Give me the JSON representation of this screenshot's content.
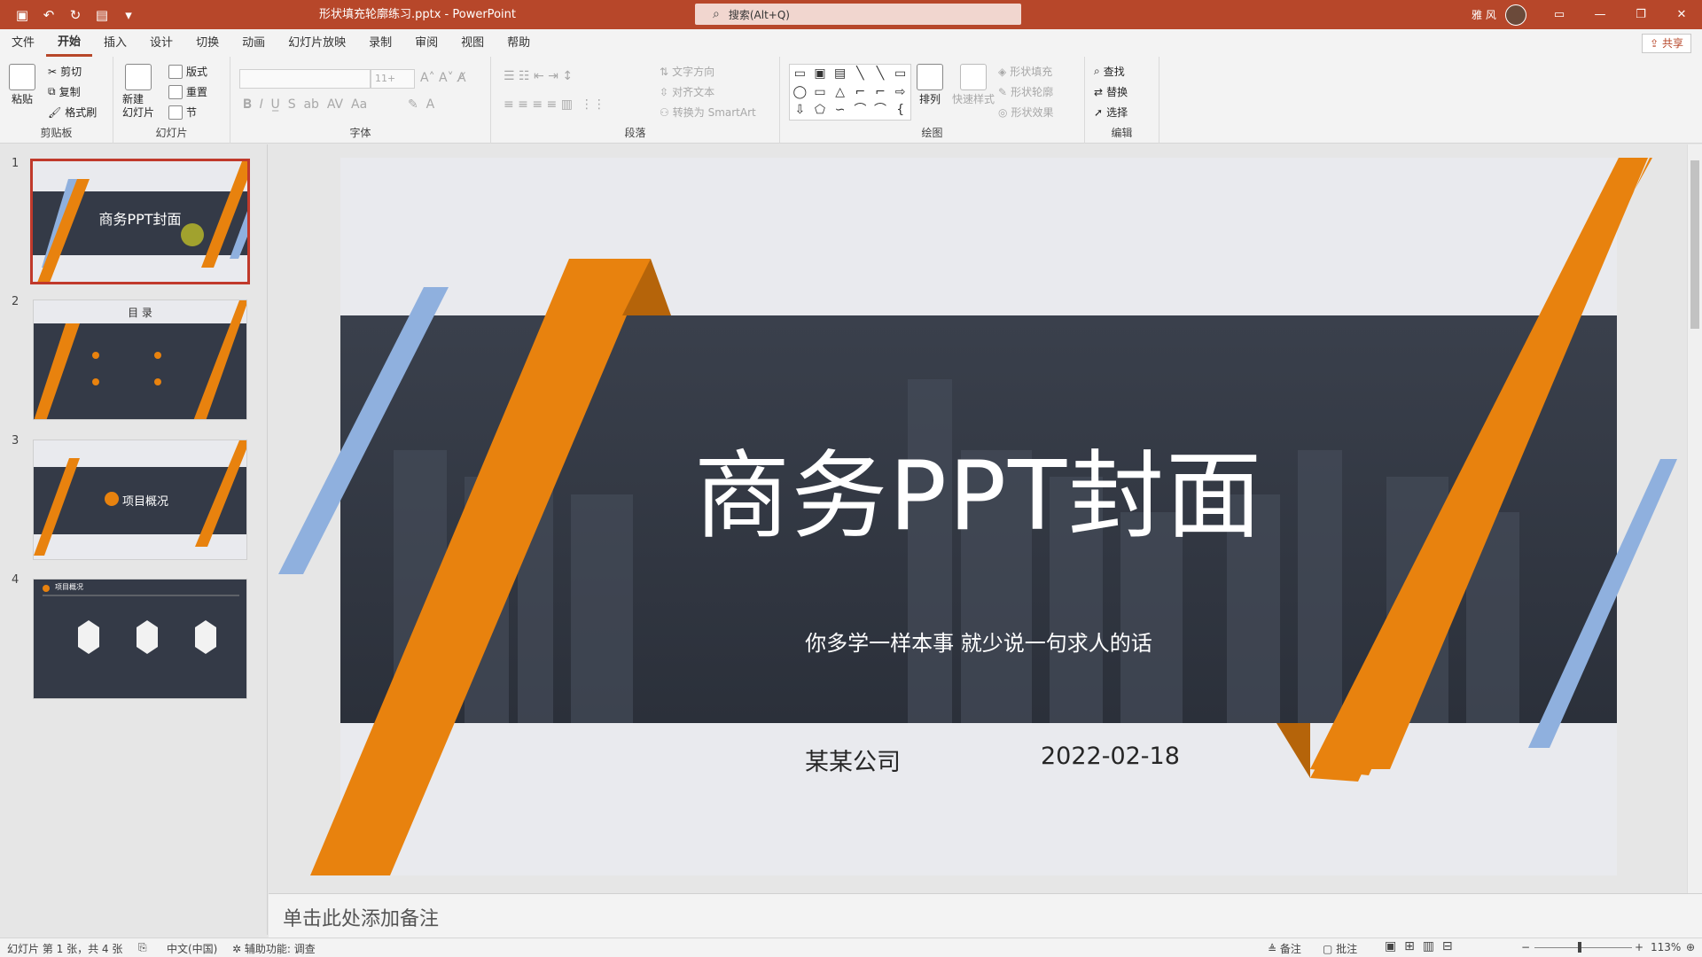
{
  "titlebar": {
    "doc_title": "形状填充轮廓练习.pptx  -  PowerPoint",
    "search_placeholder": "搜索(Alt+Q)",
    "user_name": "雅 风",
    "share_label": "共享"
  },
  "tabs": [
    "文件",
    "开始",
    "插入",
    "设计",
    "切换",
    "动画",
    "幻灯片放映",
    "录制",
    "审阅",
    "视图",
    "帮助"
  ],
  "active_tab": "开始",
  "ribbon": {
    "clipboard": {
      "label": "剪贴板",
      "paste": "粘贴",
      "cut": "剪切",
      "copy": "复制",
      "format_painter": "格式刷"
    },
    "slides": {
      "label": "幻灯片",
      "new_slide": "新建\n幻灯片",
      "layout": "版式",
      "reset": "重置",
      "section": "节"
    },
    "font": {
      "label": "字体",
      "size_placeholder": "11+"
    },
    "paragraph": {
      "label": "段落",
      "text_direction": "文字方向",
      "align_text": "对齐文本",
      "smartart": "转换为 SmartArt"
    },
    "drawing": {
      "label": "绘图",
      "arrange": "排列",
      "quick_styles": "快速样式",
      "shape_fill": "形状填充",
      "shape_outline": "形状轮廓",
      "shape_effects": "形状效果"
    },
    "editing": {
      "label": "编辑",
      "find": "查找",
      "replace": "替换",
      "select": "选择"
    }
  },
  "thumbnails": [
    {
      "num": "1",
      "title": "商务PPT封面",
      "selected": true
    },
    {
      "num": "2",
      "title": "目 录",
      "selected": false
    },
    {
      "num": "3",
      "title": "项目概况",
      "selected": false
    },
    {
      "num": "4",
      "title": "项目概况",
      "selected": false
    }
  ],
  "slide": {
    "title": "商务PPT封面",
    "subtitle": "你多学一样本事 就少说一句求人的话",
    "company": "某某公司",
    "date": "2022-02-18"
  },
  "notes_placeholder": "单击此处添加备注",
  "status": {
    "slide_info": "幻灯片 第 1 张，共 4 张",
    "language": "中文(中国)",
    "accessibility": "辅助功能: 调查",
    "notes_btn": "备注",
    "comments_btn": "批注",
    "zoom": "113%"
  },
  "colors": {
    "accent": "#b7472a",
    "orange": "#e8820e",
    "blue": "#8fb0de",
    "band": "#343a47"
  }
}
